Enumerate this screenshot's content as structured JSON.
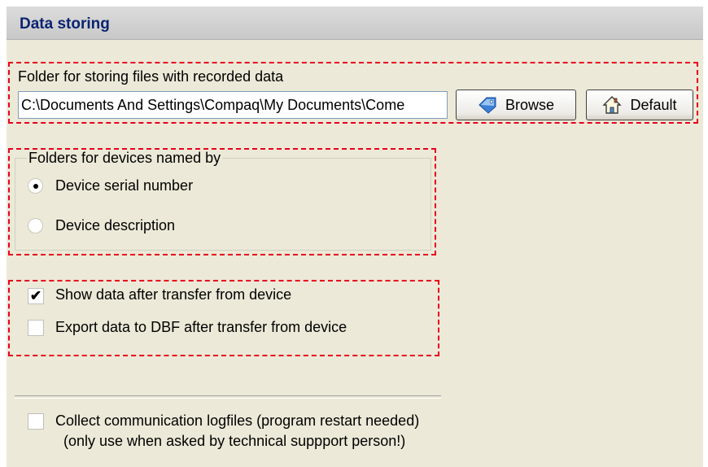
{
  "window_title": "Data storing",
  "storage": {
    "label": "Folder for storing files with recorded data",
    "path_value": "C:\\Documents And Settings\\Compaq\\My Documents\\Come",
    "browse_label": "Browse",
    "default_label": "Default"
  },
  "naming": {
    "legend": "Folders for devices named by",
    "options": [
      {
        "label": "Device serial number",
        "selected": true
      },
      {
        "label": "Device description",
        "selected": false
      }
    ]
  },
  "after_transfer": {
    "show_data": {
      "label": "Show data after transfer from device",
      "checked": true
    },
    "export_dbf": {
      "label": "Export data to DBF after transfer from device",
      "checked": false
    }
  },
  "logging": {
    "label_line1": "Collect communication logfiles (program restart needed)",
    "label_line2": "(only use when asked by technical suppport person!)",
    "checked": false
  },
  "colors": {
    "header_text": "#0a2470",
    "dashed_highlight": "#e8001c",
    "panel_background": "#ece9d8"
  }
}
